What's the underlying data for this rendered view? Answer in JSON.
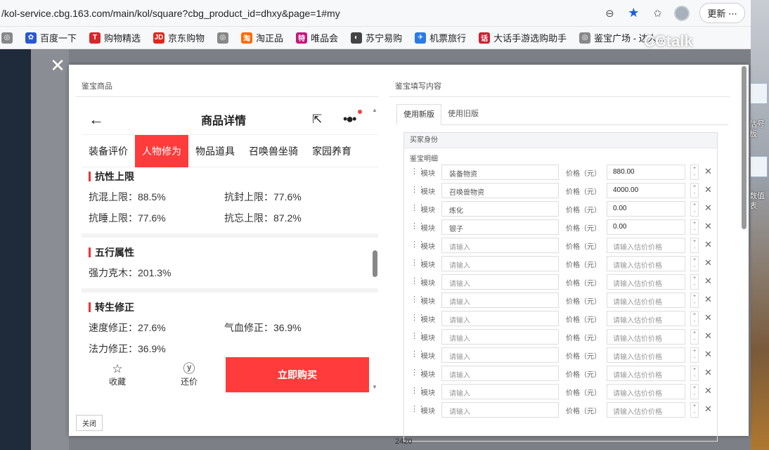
{
  "browser": {
    "url": "/kol-service.cbg.163.com/main/kol/square?cbg_product_id=dhxy&page=1#my",
    "update_label": "更新 ⋯"
  },
  "bookmarks": [
    {
      "label": "百度一下",
      "color": "#2b56d8",
      "glyph": "✿"
    },
    {
      "label": "购物精选",
      "color": "#d9262c",
      "glyph": "T"
    },
    {
      "label": "京东购物",
      "color": "#e1251b",
      "glyph": "JD"
    },
    {
      "label": "",
      "color": "#888888",
      "glyph": "◎"
    },
    {
      "label": "淘正品",
      "color": "#ff6a00",
      "glyph": "淘"
    },
    {
      "label": "唯品会",
      "color": "#c8177b",
      "glyph": "特"
    },
    {
      "label": "苏宁易购",
      "color": "#444444",
      "glyph": "◐"
    },
    {
      "label": "机票旅行",
      "color": "#2a7be4",
      "glyph": "✈"
    },
    {
      "label": "大话手游选购助手",
      "color": "#c23",
      "glyph": "话"
    },
    {
      "label": "鉴宝广场 - 达人...",
      "color": "#888888",
      "glyph": "◎"
    }
  ],
  "watermark": "CCtalk",
  "modal": {
    "left_title": "鉴宝商品",
    "right_title": "鉴宝填写内容",
    "close_label": "关闭"
  },
  "phone": {
    "title": "商品详情",
    "tabs": [
      "装备评价",
      "人物修为",
      "物品道具",
      "召唤兽坐骑",
      "家园养育"
    ],
    "active_tab": 1,
    "groups": [
      {
        "title": "抗性上限",
        "rows": [
          [
            "抗混上限：88.5%",
            "抗封上限：77.6%"
          ],
          [
            "抗睡上限：77.6%",
            "抗忘上限：87.2%"
          ]
        ]
      },
      {
        "title": "五行属性",
        "rows": [
          [
            "强力克木：201.3%",
            ""
          ]
        ]
      },
      {
        "title": "转生修正",
        "rows": [
          [
            "速度修正：27.6%",
            "气血修正：36.9%"
          ],
          [
            "法力修正：36.9%",
            ""
          ]
        ]
      }
    ],
    "footer": {
      "favorite": "收藏",
      "bargain": "还价",
      "buy": "立即购买"
    }
  },
  "form": {
    "tabs": [
      "使用新版",
      "使用旧版"
    ],
    "active_tab": 0,
    "section": "买家身份",
    "subsection": "鉴宝明细",
    "module_label": "模块",
    "price_label": "价格（元）",
    "name_placeholder": "请输入",
    "price_placeholder": "请输入估价价格",
    "rows": [
      {
        "name": "装备物资",
        "price": "880.00"
      },
      {
        "name": "召唤兽物资",
        "price": "4000.00"
      },
      {
        "name": "炼化",
        "price": "0.00"
      },
      {
        "name": "银子",
        "price": "0.00"
      },
      {
        "name": "",
        "price": ""
      },
      {
        "name": "",
        "price": ""
      },
      {
        "name": "",
        "price": ""
      },
      {
        "name": "",
        "price": ""
      },
      {
        "name": "",
        "price": ""
      },
      {
        "name": "",
        "price": ""
      },
      {
        "name": "",
        "price": ""
      },
      {
        "name": "",
        "price": ""
      },
      {
        "name": "",
        "price": ""
      },
      {
        "name": "",
        "price": ""
      }
    ]
  },
  "background": {
    "desktop_labels": [
      "估号板",
      "数值表"
    ],
    "bottom_number": "2420"
  }
}
